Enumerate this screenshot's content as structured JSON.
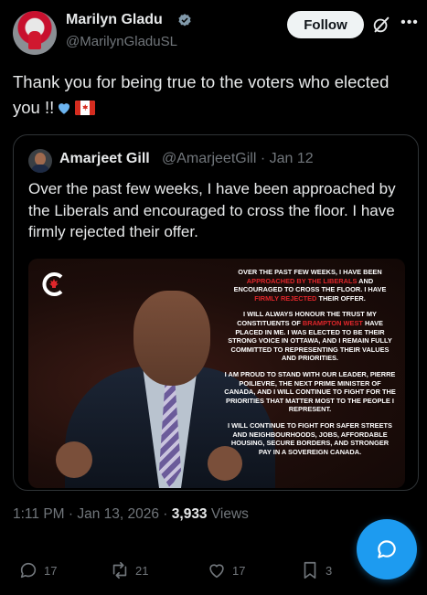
{
  "post": {
    "author_name": "Marilyn Gladu",
    "author_handle": "@MarilynGladuSL",
    "follow_label": "Follow",
    "text": "Thank you for being true to the voters who elected you !!",
    "timestamp": "1:11 PM · Jan 13, 2026 · ",
    "views_count": "3,933",
    "views_label": " Views"
  },
  "quote": {
    "author_name": "Amarjeet Gill",
    "author_handle": "@AmarjeetGill · Jan 12",
    "text": "Over the past few weeks, I have been approached by the Liberals and encouraged to cross the floor. I have firmly rejected their offer.",
    "image_text": {
      "p1_a": "OVER THE PAST FEW WEEKS, I HAVE BEEN ",
      "p1_red1": "APPROACHED BY THE LIBERALS",
      "p1_b": " AND ENCOURAGED TO CROSS THE FLOOR. I HAVE ",
      "p1_red2": "FIRMLY REJECTED",
      "p1_c": " THEIR OFFER.",
      "p2_a": "I WILL ALWAYS HONOUR THE TRUST MY CONSTITUENTS OF ",
      "p2_red": "BRAMPTON WEST",
      "p2_b": " HAVE PLACED IN ME. I WAS ELECTED TO BE THEIR STRONG VOICE IN OTTAWA, AND I REMAIN FULLY COMMITTED TO REPRESENTING THEIR VALUES AND PRIORITIES.",
      "p3": "I AM PROUD TO STAND WITH OUR LEADER, PIERRE POILIEVRE, THE NEXT PRIME MINISTER OF CANADA, AND I WILL CONTINUE TO FIGHT FOR THE PRIORITIES THAT MATTER MOST TO THE PEOPLE I REPRESENT.",
      "p4": "I WILL CONTINUE TO FIGHT FOR SAFER STREETS AND NEIGHBOURHOODS, JOBS, AFFORDABLE HOUSING, SECURE BORDERS, AND STRONGER PAY IN A SOVEREIGN CANADA."
    }
  },
  "actions": {
    "replies": "17",
    "reposts": "21",
    "likes": "17",
    "bookmarks": "3"
  },
  "icons": {
    "verified": "verified-badge-icon",
    "grok": "grok-icon",
    "more": "more-icon",
    "reply": "reply-icon",
    "repost": "repost-icon",
    "like": "heart-icon",
    "bookmark": "bookmark-icon",
    "compose": "compose-reply-icon"
  },
  "colors": {
    "accent": "#1d9bf0",
    "background": "#000000",
    "muted": "#71767b",
    "heart_emoji": "#6cb4f0",
    "image_highlight": "#e0262b"
  }
}
